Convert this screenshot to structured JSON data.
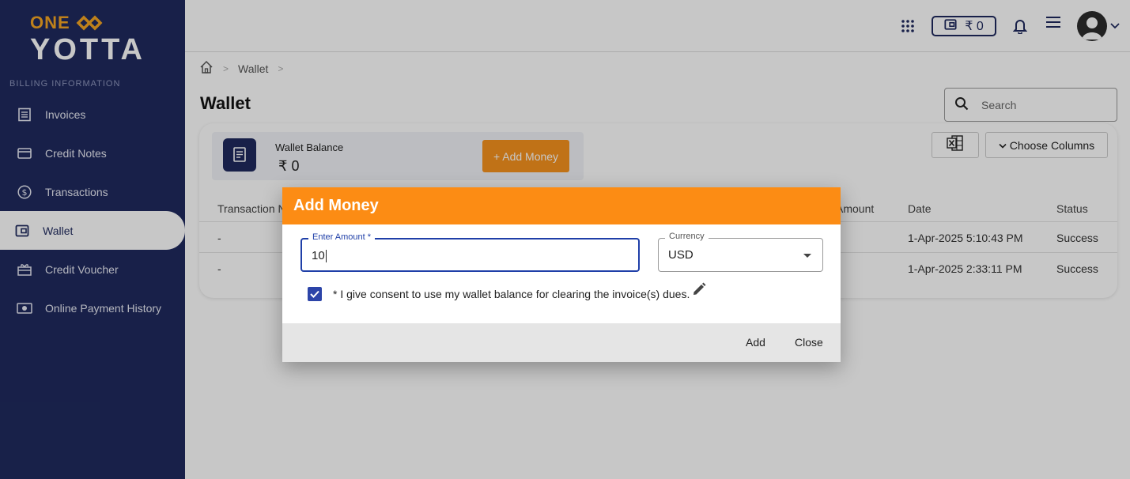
{
  "brand": {
    "line1": "ONE",
    "line2": "YOTTA"
  },
  "sidebar": {
    "heading": "BILLING INFORMATION",
    "items": [
      {
        "label": "Invoices",
        "icon": "list-icon"
      },
      {
        "label": "Credit Notes",
        "icon": "card-icon"
      },
      {
        "label": "Transactions",
        "icon": "dollar-icon"
      },
      {
        "label": "Wallet",
        "icon": "wallet-icon",
        "active": true
      },
      {
        "label": "Credit Voucher",
        "icon": "voucher-icon"
      },
      {
        "label": "Online Payment History",
        "icon": "cash-icon"
      }
    ]
  },
  "topbar": {
    "wallet_amount": "₹ 0"
  },
  "breadcrumb": {
    "current": "Wallet"
  },
  "page": {
    "title": "Wallet"
  },
  "search": {
    "placeholder": "Search"
  },
  "wallet": {
    "balance_label": "Wallet Balance",
    "balance_value": "₹ 0",
    "add_money_label": "+ Add Money"
  },
  "toolbar": {
    "choose_columns_label": "Choose Columns"
  },
  "table": {
    "headers": [
      "Transaction N",
      "Amount",
      "Date",
      "Status"
    ],
    "rows": [
      {
        "txn": "-",
        "date": "1-Apr-2025 5:10:43 PM",
        "status": "Success"
      },
      {
        "txn": "-",
        "date": "1-Apr-2025 2:33:11 PM",
        "status": "Success"
      }
    ]
  },
  "dialog": {
    "title": "Add Money",
    "amount_label": "Enter Amount *",
    "amount_value": "10",
    "currency_label": "Currency",
    "currency_value": "USD",
    "consent_text": "* I give consent to use my wallet balance for clearing the invoice(s) dues.",
    "add_label": "Add",
    "close_label": "Close"
  },
  "colors": {
    "sidebar": "#1f2a5e",
    "accent": "#fc8c14",
    "primary": "#2c44a8"
  }
}
